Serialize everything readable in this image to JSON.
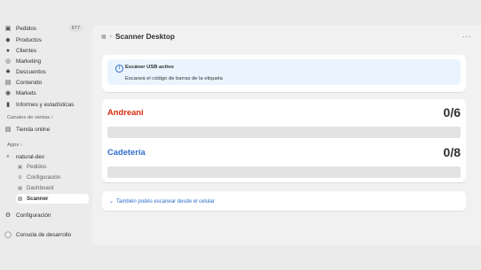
{
  "sidebar": {
    "items": [
      {
        "label": "Pedidos",
        "icon": "orders-icon",
        "badge": "677"
      },
      {
        "label": "Productos",
        "icon": "tag-icon"
      },
      {
        "label": "Clientes",
        "icon": "person-icon"
      },
      {
        "label": "Marketing",
        "icon": "target-icon"
      },
      {
        "label": "Descuentos",
        "icon": "discount-icon"
      },
      {
        "label": "Contenido",
        "icon": "content-icon"
      },
      {
        "label": "Markets",
        "icon": "globe-icon"
      },
      {
        "label": "Informes y estadísticas",
        "icon": "chart-icon"
      }
    ],
    "sales_channels_label": "Canales de ventas",
    "online_store": "Tienda online",
    "apps_label": "Apps",
    "app_name": "natural-dev",
    "app_sub_items": [
      {
        "label": "Pedidos"
      },
      {
        "label": "Configuración"
      },
      {
        "label": "Dashboard"
      },
      {
        "label": "Scanner"
      }
    ],
    "settings": "Configuración",
    "dev_console": "Consola de desarrollo"
  },
  "page": {
    "title": "Scanner Desktop",
    "more_label": "···"
  },
  "banner": {
    "title": "Escáner USB activo",
    "body": "Escaneá el código de barras de la etiqueta"
  },
  "carriers": [
    {
      "name": "Andreani",
      "count": "0/6",
      "progress": 0,
      "color": "#d72c0d"
    },
    {
      "name": "Cadetería",
      "count": "0/8",
      "progress": 0,
      "color": "#2c6ecb"
    }
  ],
  "mobile_link": "También podés escanear desde el celular",
  "colors": {
    "accent": "#2c6ecb",
    "danger": "#d72c0d"
  }
}
